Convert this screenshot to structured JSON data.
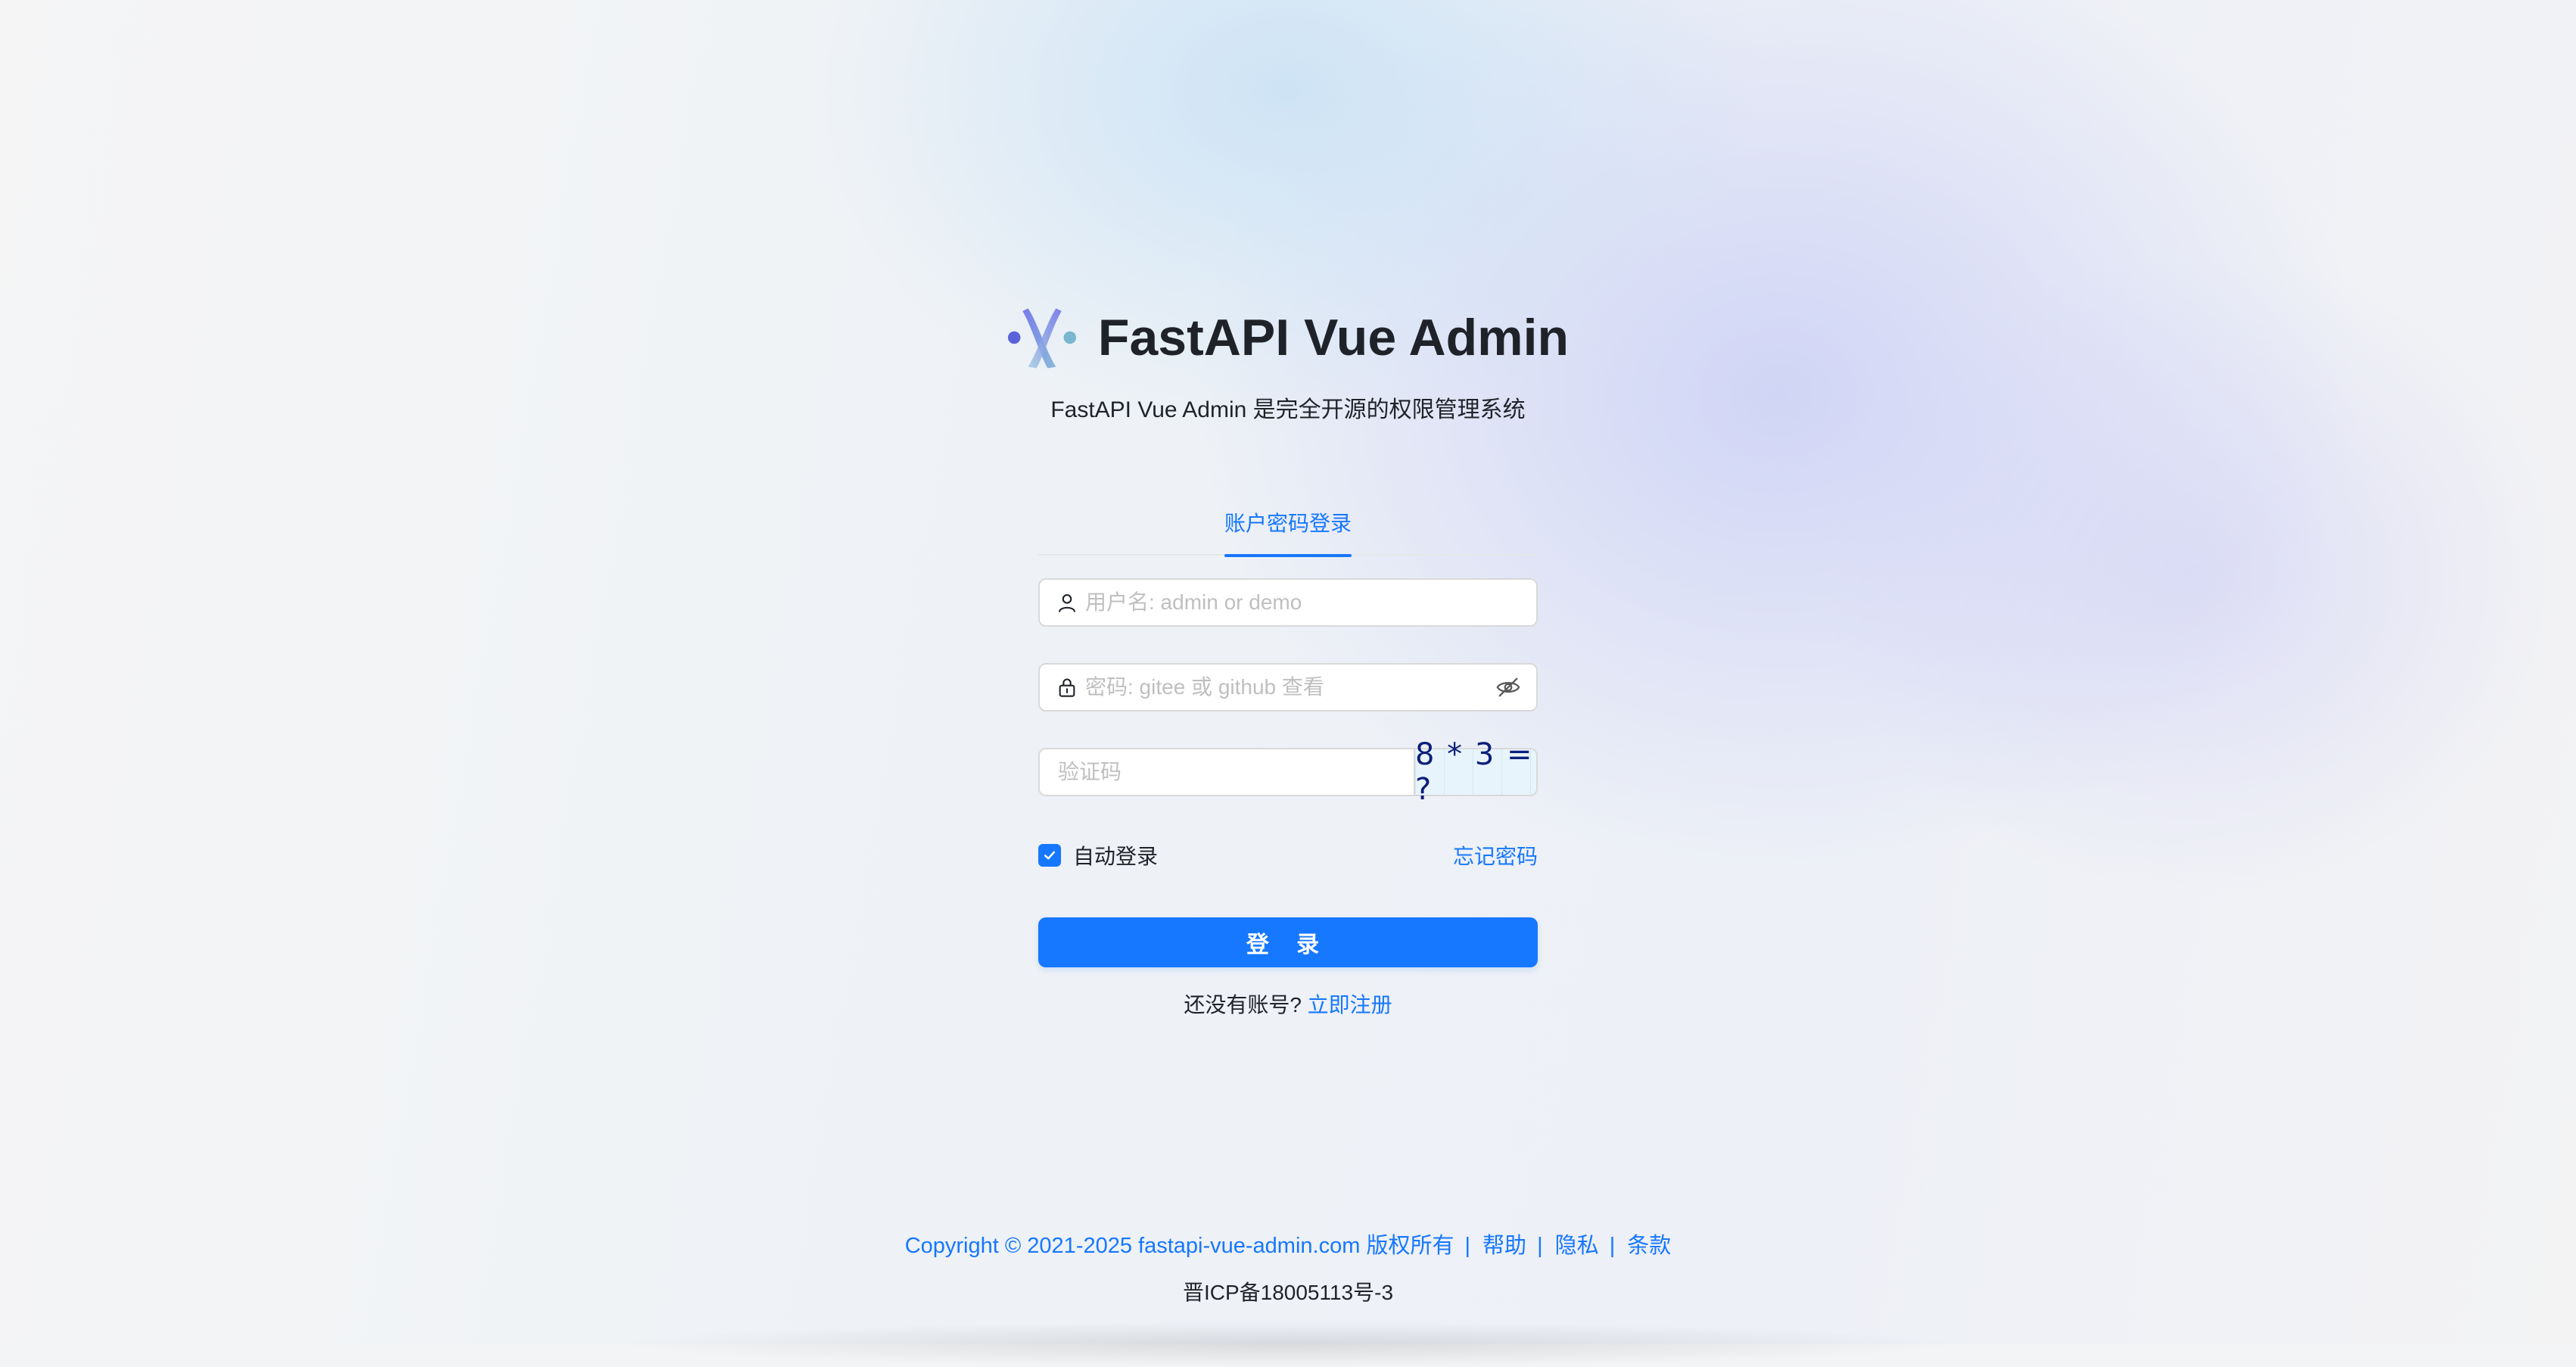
{
  "brand": {
    "title": "FastAPI Vue Admin",
    "subtitle": "FastAPI Vue Admin 是完全开源的权限管理系统",
    "logo_icon": "fastapi-vue-admin-logo"
  },
  "login": {
    "tab_label": "账户密码登录",
    "username": {
      "placeholder": "用户名: admin or demo",
      "value": "",
      "icon": "user-icon"
    },
    "password": {
      "placeholder": "密码: gitee 或 github 查看",
      "value": "",
      "icon": "lock-icon",
      "toggle_icon": "eye-invisible-icon"
    },
    "captcha": {
      "placeholder": "验证码",
      "value": "",
      "image_text": "8 * 3 = ?"
    },
    "remember_label": "自动登录",
    "remember_checked": true,
    "forgot_label": "忘记密码",
    "submit_label": "登 录",
    "register_prompt": "还没有账号?",
    "register_link": "立即注册"
  },
  "footer": {
    "copyright": "Copyright © 2021-2025 fastapi-vue-admin.com 版权所有",
    "links": [
      "帮助",
      "隐私",
      "条款"
    ],
    "icp": "晋ICP备18005113号-3"
  },
  "colors": {
    "primary": "#1677ff",
    "text": "#1f2329",
    "placeholder": "#bfbfbf",
    "captcha_text": "#0b1f7a"
  }
}
